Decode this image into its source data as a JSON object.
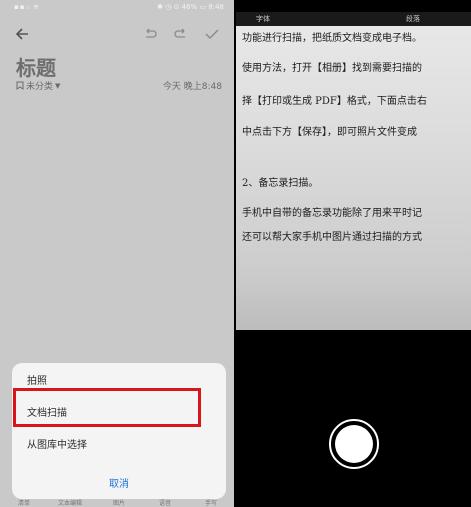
{
  "status": {
    "left": "▪▪ᵢₗ ≋",
    "right": "✱ ◷ ⊙ 46% ▭ 8:48"
  },
  "toolbar": {
    "icons": [
      "back-arrow-icon",
      "undo-icon",
      "redo-icon",
      "check-icon"
    ]
  },
  "note": {
    "title": "标题",
    "category": "未分类",
    "timestamp": "今天 晚上8:48"
  },
  "bottom_tabs": [
    "清单",
    "文本编辑",
    "图片",
    "语音",
    "手写"
  ],
  "sheet": {
    "options": [
      "拍照",
      "文档扫描",
      "从图库中选择"
    ],
    "cancel": "取消",
    "highlighted_option": "文档扫描",
    "highlight_color": "#d9141a"
  },
  "camera": {
    "doc_header": [
      "字体",
      "段落"
    ],
    "doc_lines": [
      "功能进行扫描，把纸质文档变成电子档。",
      "使用方法，打开【相册】找到需要扫描的",
      "择【打印或生成 PDF】格式，下面点击右",
      "中点击下方【保存】，即可照片文件变成",
      "2、备忘录扫描。",
      "手机中自带的备忘录功能除了用来平时记",
      "还可以帮大家手机中图片通过扫描的方式"
    ],
    "shutter_icon": "shutter-button-icon"
  }
}
